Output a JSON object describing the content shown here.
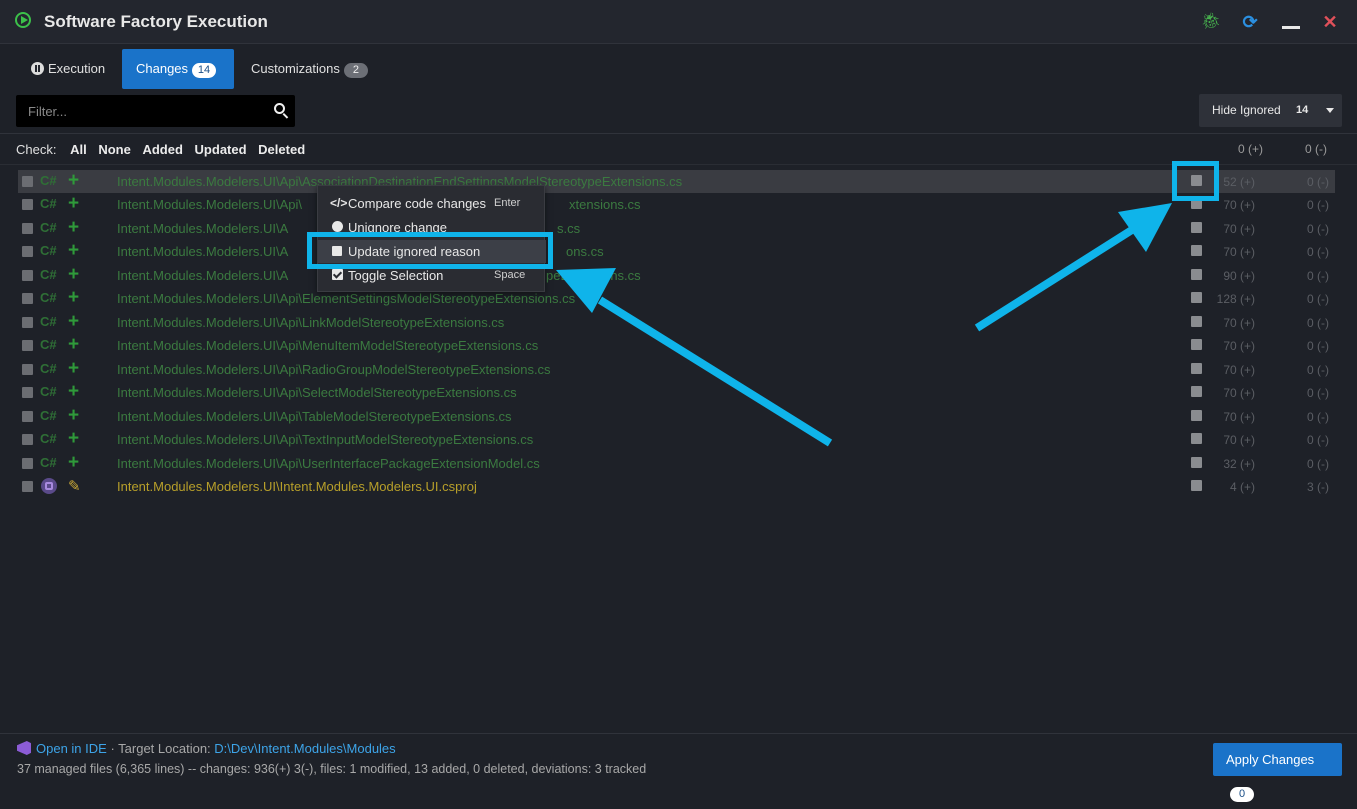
{
  "window": {
    "title": "Software Factory Execution"
  },
  "tabs": [
    {
      "label": "Execution"
    },
    {
      "label": "Changes",
      "badge": "14"
    },
    {
      "label": "Customizations",
      "badge": "2"
    }
  ],
  "filter": {
    "placeholder": "Filter..."
  },
  "hide_ignored": {
    "label": "Hide Ignored",
    "count": "14"
  },
  "check": {
    "label": "Check:",
    "options": [
      "All",
      "None",
      "Added",
      "Updated",
      "Deleted"
    ]
  },
  "totals": {
    "added": "0 (+)",
    "deleted": "0 (-)"
  },
  "rows": [
    {
      "lang": "C#",
      "path": "Intent.Modules.Modelers.UI\\Api\\AssociationDestinationEndSettingsModelStereotypeExtensions.cs",
      "added": "52 (+)",
      "deleted": "0 (-)"
    },
    {
      "lang": "C#",
      "path_prefix": "Intent.Modules.Modelers.UI\\Api\\",
      "path_suffix": "xtensions.cs",
      "added": "70 (+)",
      "deleted": "0 (-)"
    },
    {
      "lang": "C#",
      "path_prefix": "Intent.Modules.Modelers.UI\\A",
      "path_suffix": "s.cs",
      "added": "70 (+)",
      "deleted": "0 (-)"
    },
    {
      "lang": "C#",
      "path_prefix": "Intent.Modules.Modelers.UI\\A",
      "path_suffix": "ons.cs",
      "added": "70 (+)",
      "deleted": "0 (-)"
    },
    {
      "lang": "C#",
      "path_prefix": "Intent.Modules.Modelers.UI\\A",
      "path_suffix": "peExtensions.cs",
      "added": "90 (+)",
      "deleted": "0 (-)"
    },
    {
      "lang": "C#",
      "path": "Intent.Modules.Modelers.UI\\Api\\ElementSettingsModelStereotypeExtensions.cs",
      "added": "128 (+)",
      "deleted": "0 (-)"
    },
    {
      "lang": "C#",
      "path": "Intent.Modules.Modelers.UI\\Api\\LinkModelStereotypeExtensions.cs",
      "added": "70 (+)",
      "deleted": "0 (-)"
    },
    {
      "lang": "C#",
      "path": "Intent.Modules.Modelers.UI\\Api\\MenuItemModelStereotypeExtensions.cs",
      "added": "70 (+)",
      "deleted": "0 (-)"
    },
    {
      "lang": "C#",
      "path": "Intent.Modules.Modelers.UI\\Api\\RadioGroupModelStereotypeExtensions.cs",
      "added": "70 (+)",
      "deleted": "0 (-)"
    },
    {
      "lang": "C#",
      "path": "Intent.Modules.Modelers.UI\\Api\\SelectModelStereotypeExtensions.cs",
      "added": "70 (+)",
      "deleted": "0 (-)"
    },
    {
      "lang": "C#",
      "path": "Intent.Modules.Modelers.UI\\Api\\TableModelStereotypeExtensions.cs",
      "added": "70 (+)",
      "deleted": "0 (-)"
    },
    {
      "lang": "C#",
      "path": "Intent.Modules.Modelers.UI\\Api\\TextInputModelStereotypeExtensions.cs",
      "added": "70 (+)",
      "deleted": "0 (-)"
    },
    {
      "lang": "C#",
      "path": "Intent.Modules.Modelers.UI\\Api\\UserInterfacePackageExtensionModel.cs",
      "added": "32 (+)",
      "deleted": "0 (-)"
    },
    {
      "path": "Intent.Modules.Modelers.UI\\Intent.Modules.Modelers.UI.csproj",
      "added": "4 (+)",
      "deleted": "3 (-)"
    }
  ],
  "context_menu": [
    {
      "label": "Compare code changes",
      "shortcut": "Enter"
    },
    {
      "label": "Unignore change"
    },
    {
      "label": "Update ignored reason"
    },
    {
      "label": "Toggle Selection",
      "shortcut": "Space"
    }
  ],
  "footer": {
    "open_ide": "Open in IDE",
    "target_label": "· Target Location:",
    "target_path": "D:\\Dev\\Intent.Modules\\Modules",
    "stats": "37 managed files (6,365 lines) -- changes: 936(+) 3(-), files: 1 modified, 13 added, 0 deleted, deviations: 3 tracked"
  },
  "apply": {
    "label": "Apply Changes",
    "badge": "0"
  },
  "colors": {
    "accent": "#1a73c9",
    "highlight": "#0fb4ea",
    "added": "#3b7a40",
    "modified": "#b79f2a"
  }
}
